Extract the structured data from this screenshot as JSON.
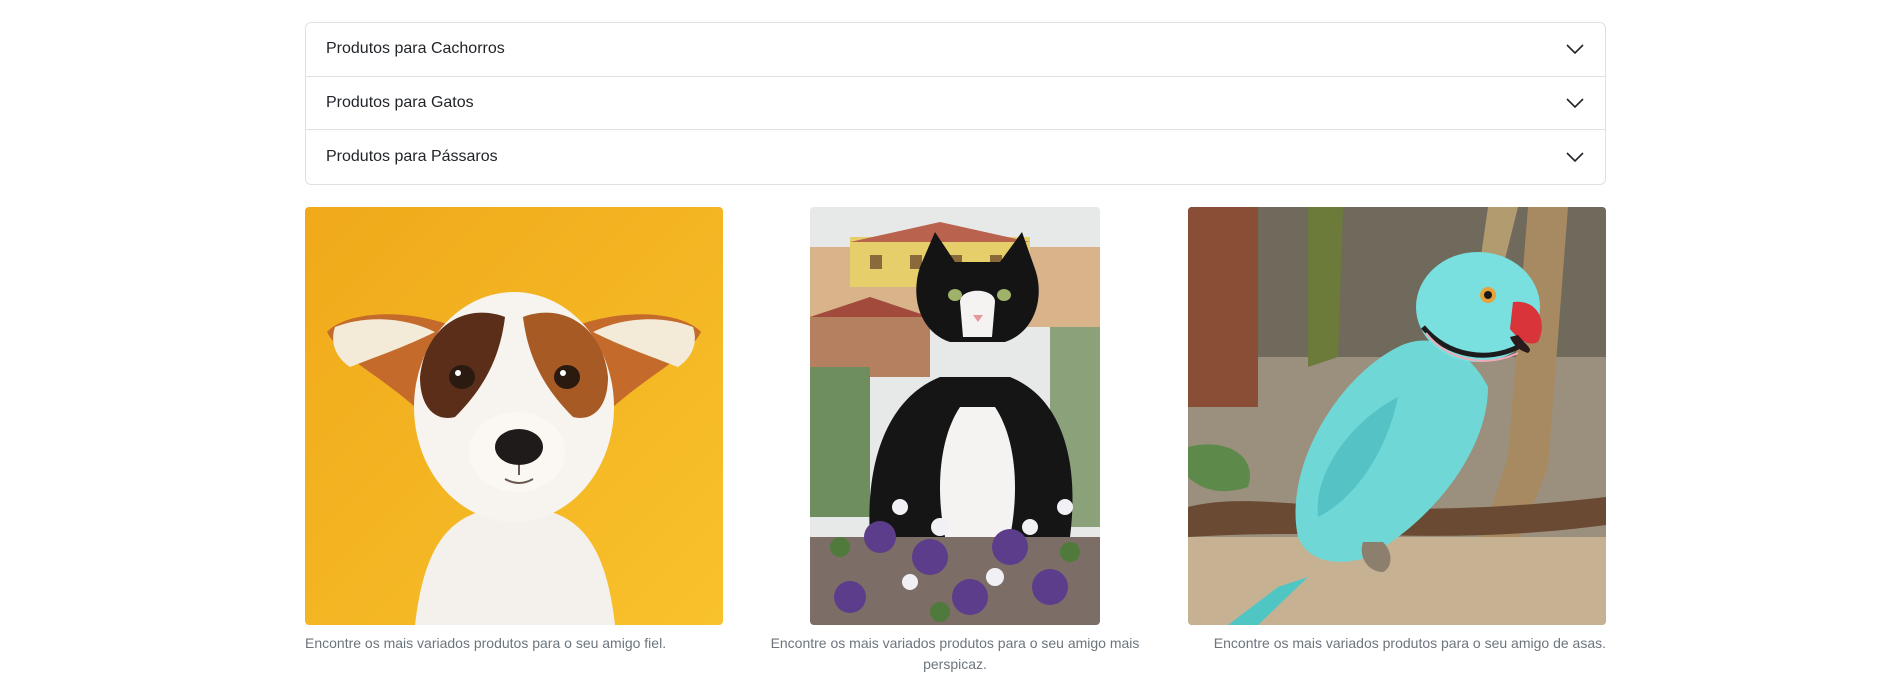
{
  "accordion": {
    "items": [
      {
        "label": "Produtos para Cachorros"
      },
      {
        "label": "Produtos para Gatos"
      },
      {
        "label": "Produtos para Pássaros"
      }
    ]
  },
  "gallery": {
    "items": [
      {
        "caption": "Encontre os mais variados produtos para o seu amigo fiel.",
        "subject": "dog"
      },
      {
        "caption": "Encontre os mais variados produtos para o seu amigo mais perspicaz.",
        "subject": "cat"
      },
      {
        "caption": "Encontre os mais variados produtos para o seu amigo de asas.",
        "subject": "parrot"
      }
    ]
  },
  "colors": {
    "border": "#dee2e6",
    "caption_text": "#6c757d",
    "dog_background": "#f5b321",
    "parrot": "#6fd8d6"
  }
}
